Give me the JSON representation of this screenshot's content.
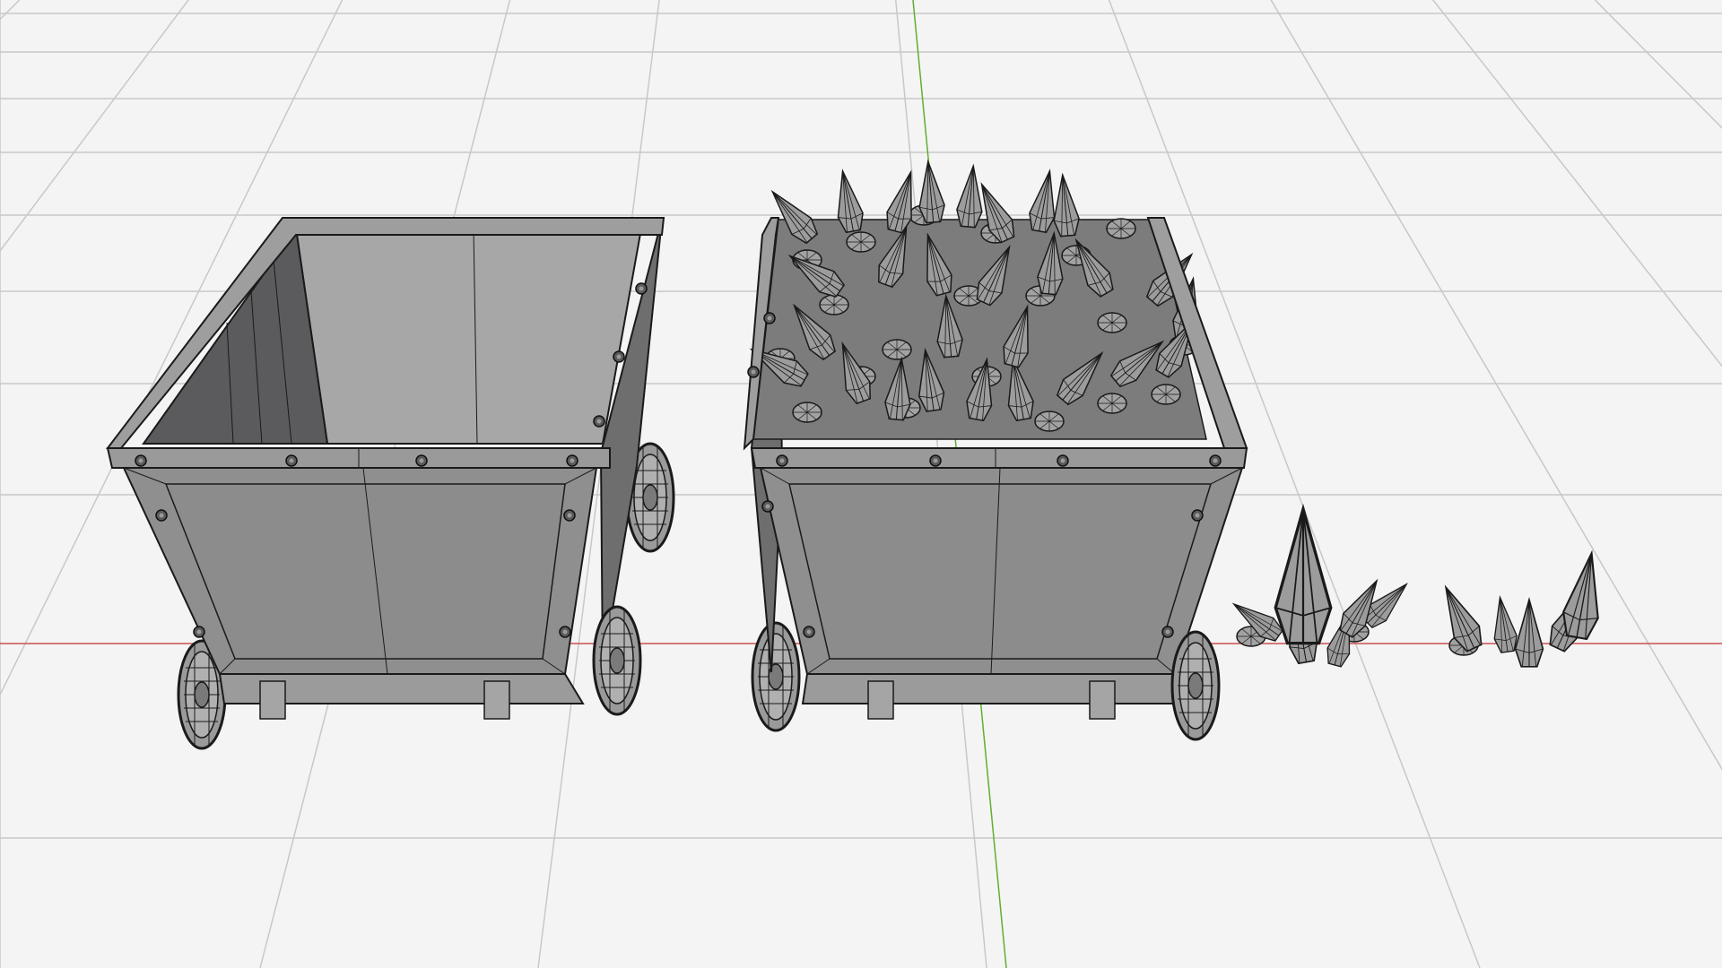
{
  "viewport": {
    "mode": "3d-viewport",
    "shading": "solid-wireframe",
    "background_color": "#f4f4f4",
    "grid_color": "#c8c8c8",
    "x_axis_color": "#d23c3c",
    "y_axis_color": "#5fae32",
    "mesh_color": "#8f8f8f",
    "mesh_dark_color": "#5a5a5a",
    "wire_color": "#1a1a1a"
  },
  "objects": [
    {
      "name": "mine-cart-empty",
      "icon": "mine-cart-icon"
    },
    {
      "name": "mine-cart-with-crystals",
      "icon": "mine-cart-icon"
    },
    {
      "name": "crystal-cluster-large",
      "icon": "crystal-icon"
    },
    {
      "name": "crystal-cluster-small",
      "icon": "crystal-icon"
    }
  ]
}
